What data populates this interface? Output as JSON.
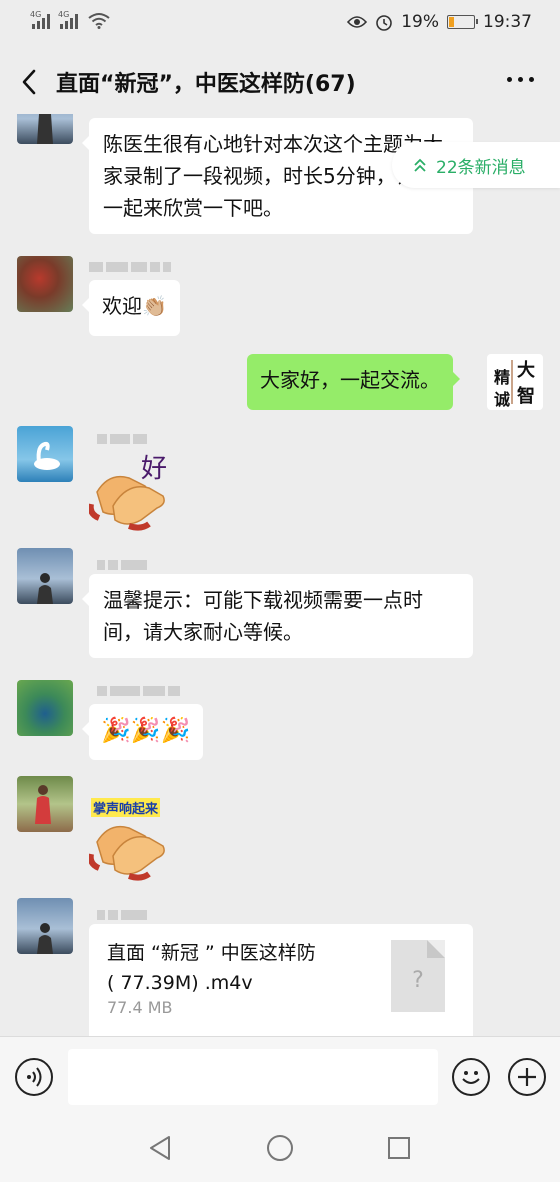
{
  "status_bar": {
    "signal1_tag": "4G",
    "signal2_tag": "4G",
    "battery_percent": "19%",
    "time": "19:37",
    "battery_level": 0.19,
    "battery_color": "#f0a020"
  },
  "header": {
    "title": "直面“新冠”，中医这样防(67)"
  },
  "new_messages_pill": {
    "label": "22条新消息"
  },
  "messages": [
    {
      "text": "陈医生很有心地针对本次这个主题为大家录制了一段视频，时长5分钟，让我们一起来欣赏一下吧。"
    },
    {
      "text": "欢迎👏🏼"
    },
    {
      "text": "大家好，一起交流。"
    },
    {
      "sticker_text": "好"
    },
    {
      "text": "温馨提示：可能下载视频需要一点时间，请大家耐心等候。"
    },
    {
      "text": "🎉🎉🎉"
    },
    {
      "sticker_text": "掌声响起来"
    }
  ],
  "my_avatar": {
    "line1": "大",
    "line2": "智",
    "line3": "精",
    "line4": "诚"
  },
  "file": {
    "name_line1": "直面 “新冠 ” 中医这样防",
    "name_line2": "( 77.39M) .m4v",
    "size": "77.4 MB",
    "icon_glyph": "?"
  },
  "colors": {
    "my_bubble": "#95ec69",
    "accent_green": "#2aae67",
    "background": "#ededed"
  }
}
